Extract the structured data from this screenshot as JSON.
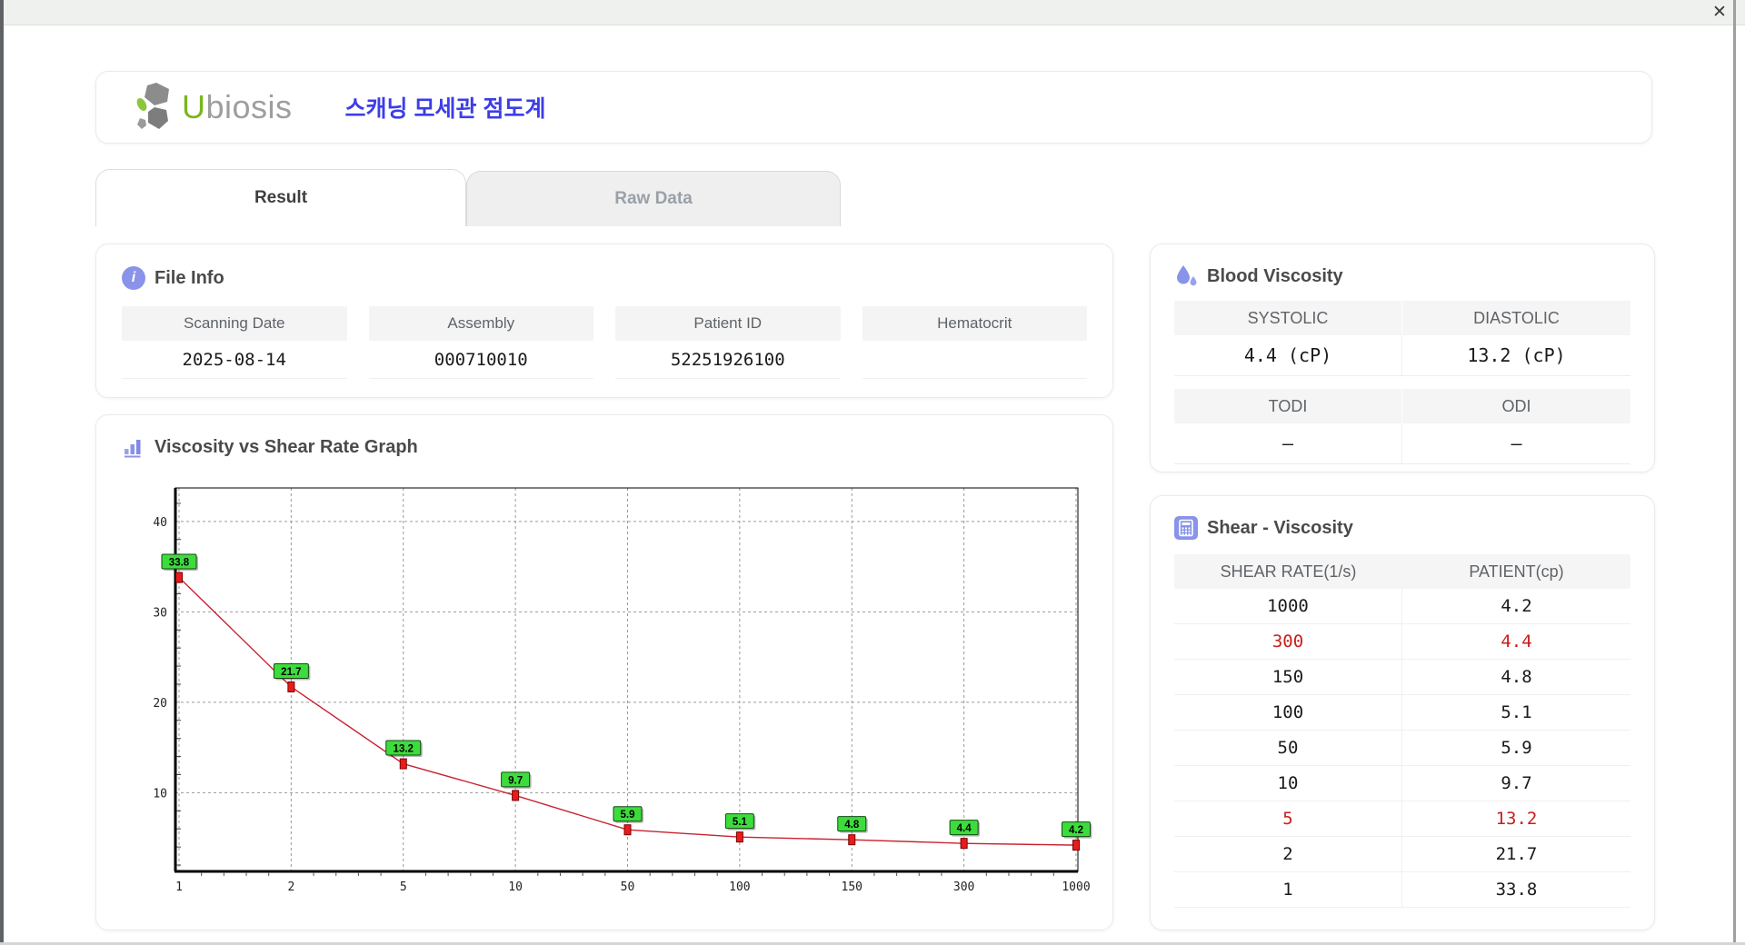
{
  "window": {
    "close_icon": "✕"
  },
  "header": {
    "logo_u": "U",
    "logo_rest": "biosis",
    "title": "스캐닝 모세관 점도계"
  },
  "tabs": [
    {
      "label": "Result",
      "active": true
    },
    {
      "label": "Raw Data",
      "active": false
    }
  ],
  "file_info": {
    "title": "File Info",
    "fields": [
      {
        "label": "Scanning Date",
        "value": "2025-08-14"
      },
      {
        "label": "Assembly",
        "value": "000710010"
      },
      {
        "label": "Patient ID",
        "value": "52251926100"
      },
      {
        "label": "Hematocrit",
        "value": ""
      }
    ]
  },
  "blood_viscosity": {
    "title": "Blood Viscosity",
    "groups": [
      {
        "cells": [
          {
            "label": "SYSTOLIC",
            "value": "4.4 (cP)"
          },
          {
            "label": "DIASTOLIC",
            "value": "13.2 (cP)"
          }
        ]
      },
      {
        "cells": [
          {
            "label": "TODI",
            "value": "–"
          },
          {
            "label": "ODI",
            "value": "–"
          }
        ]
      }
    ]
  },
  "chart_data": {
    "type": "line",
    "title": "Viscosity vs Shear Rate Graph",
    "x_categories": [
      "1",
      "2",
      "5",
      "10",
      "50",
      "100",
      "150",
      "300",
      "1000"
    ],
    "values": [
      33.8,
      21.7,
      13.2,
      9.7,
      5.9,
      5.1,
      4.8,
      4.4,
      4.2
    ],
    "point_labels": [
      "33.8",
      "21.7",
      "13.2",
      "9.7",
      "5.9",
      "5.1",
      "4.8",
      "4.4",
      "4.2"
    ],
    "xlabel": "",
    "ylabel": "",
    "y_ticks": [
      10,
      20,
      30,
      40
    ],
    "ylim": [
      1.3,
      43.7
    ],
    "x_axis_type": "category-equal-spacing",
    "grid": "dashed",
    "legend": "none",
    "line_color": "#c82332",
    "marker_color": "#e81c1c",
    "marker_border": "#7a0000",
    "label_bg": "#3ddc3d",
    "label_border": "#134a13"
  },
  "shear_table": {
    "title": "Shear - Viscosity",
    "columns": [
      "SHEAR RATE(1/s)",
      "PATIENT(cp)"
    ],
    "highlight_color": "#c81e1e",
    "rows": [
      {
        "shear": "1000",
        "patient": "4.2",
        "highlight": false
      },
      {
        "shear": "300",
        "patient": "4.4",
        "highlight": true
      },
      {
        "shear": "150",
        "patient": "4.8",
        "highlight": false
      },
      {
        "shear": "100",
        "patient": "5.1",
        "highlight": false
      },
      {
        "shear": "50",
        "patient": "5.9",
        "highlight": false
      },
      {
        "shear": "10",
        "patient": "9.7",
        "highlight": false
      },
      {
        "shear": "5",
        "patient": "13.2",
        "highlight": true
      },
      {
        "shear": "2",
        "patient": "21.7",
        "highlight": false
      },
      {
        "shear": "1",
        "patient": "33.8",
        "highlight": false
      }
    ]
  },
  "colors": {
    "accent_periwinkle": "#8a93ea",
    "title_blue": "#3d3de8",
    "logo_green": "#7cb51e",
    "logo_gray": "#9e9e9e",
    "highlight_red": "#c81e1e"
  }
}
